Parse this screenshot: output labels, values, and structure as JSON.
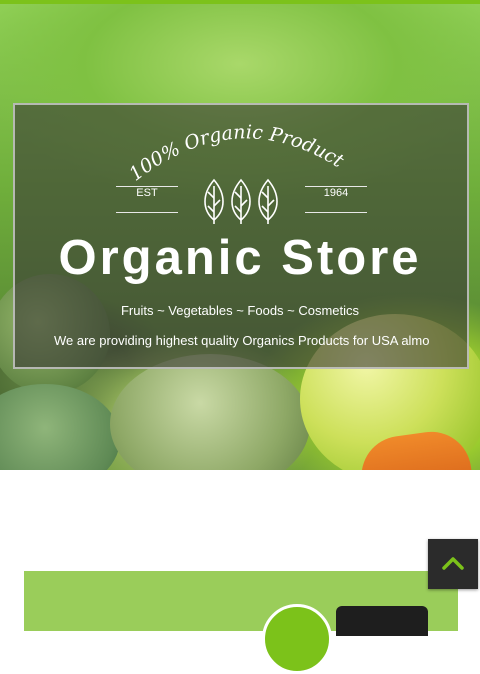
{
  "hero": {
    "badge_text": "100% Organic Products",
    "est_label": "EST",
    "year": "1964",
    "title": "Organic Store",
    "subtitle": "Fruits ~ Vegetables ~ Foods ~ Cosmetics",
    "description": "We are providing highest quality Organics Products for USA almo"
  },
  "icons": {
    "leaves": "leaf-icon",
    "back_to_top": "chevron-up-icon"
  },
  "colors": {
    "accent": "#7cc21a",
    "overlay": "#3c3c37",
    "back_to_top_bg": "#2b2b2b",
    "promo_bg": "#9acd5a"
  }
}
